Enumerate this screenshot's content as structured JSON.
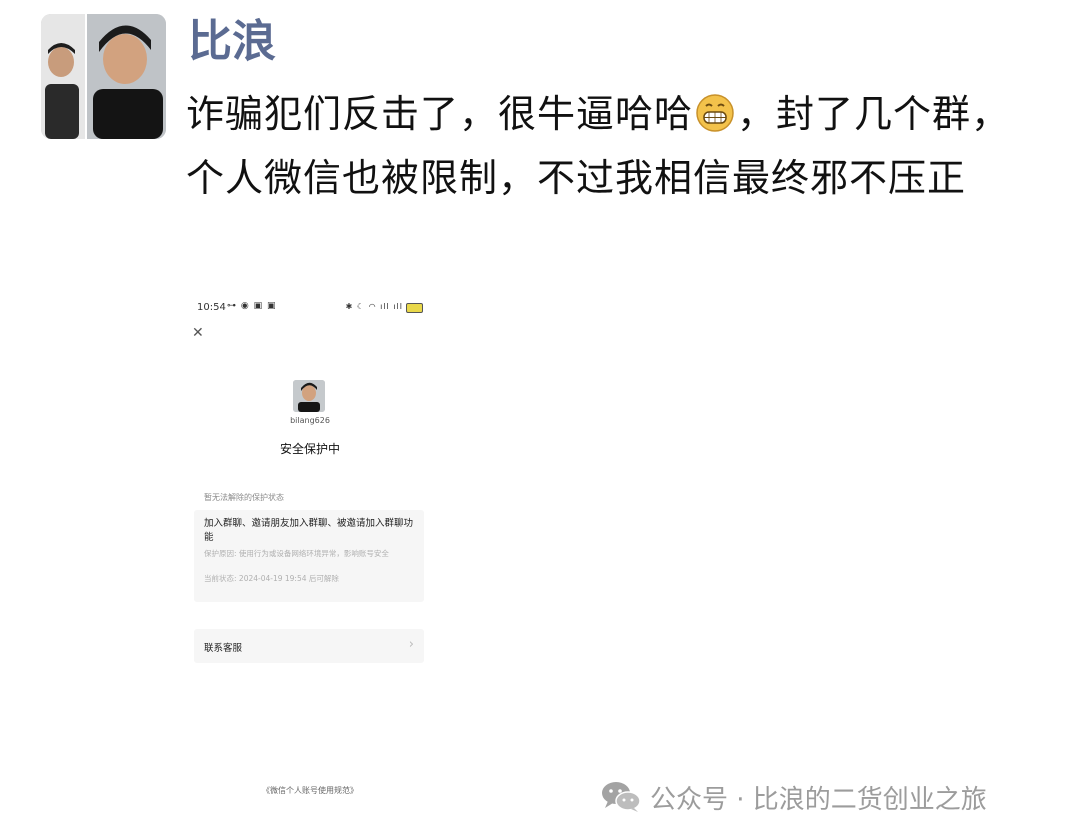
{
  "post": {
    "author_name": "比浪",
    "text_before_emoji": "诈骗犯们反击了，很牛逼哈哈",
    "emoji": "grinning-face-emoji",
    "text_after_emoji": "，封了几个群，个人微信也被限制，不过我相信最终邪不压正"
  },
  "screenshot": {
    "status_bar": {
      "time": "10:54",
      "left_icons": "⊶ ◉ ▣ ▣",
      "right_icons": "✱ ☾ ◠ ıll ıll",
      "battery_text": "11"
    },
    "close_icon": "close-icon",
    "username": "bilang626",
    "status_title": "安全保护中",
    "section_label": "暂无法解除的保护状态",
    "restriction": {
      "title": "加入群聊、邀请朋友加入群聊、被邀请加入群聊功能",
      "reason_label": "保护原因:",
      "reason_text": "使用行为或设备网络环境异常，影响账号安全",
      "status_label": "当前状态:",
      "status_text": "2024-04-19 19:54 后可解除"
    },
    "support_label": "联系客服",
    "support_chevron": "›",
    "policy_link": "《微信个人账号使用规范》"
  },
  "watermark": {
    "text": "公众号 · 比浪的二货创业之旅",
    "icon": "wechat-icon"
  },
  "colors": {
    "author_name": "#5b6b92",
    "watermark": "#9c9c9c",
    "card_bg": "#f6f6f6"
  }
}
